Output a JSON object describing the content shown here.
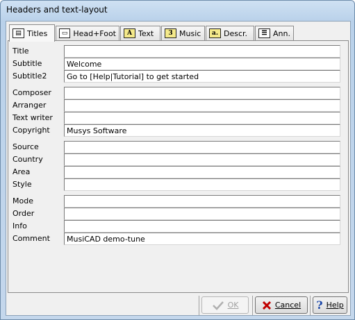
{
  "window": {
    "title": "Headers and text-layout"
  },
  "tabs": [
    {
      "label": "Titles",
      "icon": "titles-icon"
    },
    {
      "label": "Head+Foot",
      "icon": "head-foot-icon"
    },
    {
      "label": "Text",
      "icon": "text-icon"
    },
    {
      "label": "Music",
      "icon": "music-icon"
    },
    {
      "label": "Descr.",
      "icon": "description-icon"
    },
    {
      "label": "Ann.",
      "icon": "annotation-icon"
    }
  ],
  "fields": {
    "title": {
      "label": "Title",
      "value": ""
    },
    "subtitle": {
      "label": "Subtitle",
      "value": "Welcome"
    },
    "subtitle2": {
      "label": "Subtitle2",
      "value": "Go to  [Help|Tutorial] to get started"
    },
    "composer": {
      "label": "Composer",
      "value": ""
    },
    "arranger": {
      "label": "Arranger",
      "value": ""
    },
    "text_writer": {
      "label": "Text writer",
      "value": ""
    },
    "copyright": {
      "label": "Copyright",
      "value": "Musys Software"
    },
    "source": {
      "label": "Source",
      "value": ""
    },
    "country": {
      "label": "Country",
      "value": ""
    },
    "area": {
      "label": "Area",
      "value": ""
    },
    "style": {
      "label": "Style",
      "value": ""
    },
    "mode": {
      "label": "Mode",
      "value": ""
    },
    "order": {
      "label": "Order",
      "value": ""
    },
    "info": {
      "label": "Info",
      "value": ""
    },
    "comment": {
      "label": "Comment",
      "value": "MusiCAD demo-tune"
    }
  },
  "buttons": {
    "ok": {
      "label": "OK",
      "enabled": false,
      "icon": "checkmark-icon"
    },
    "cancel": {
      "label": "Cancel",
      "icon": "red-x-icon"
    },
    "help": {
      "label": "Help",
      "icon": "question-mark-icon"
    }
  },
  "colors": {
    "cancel_icon": "#c00000",
    "help_icon": "#1a46a8"
  }
}
